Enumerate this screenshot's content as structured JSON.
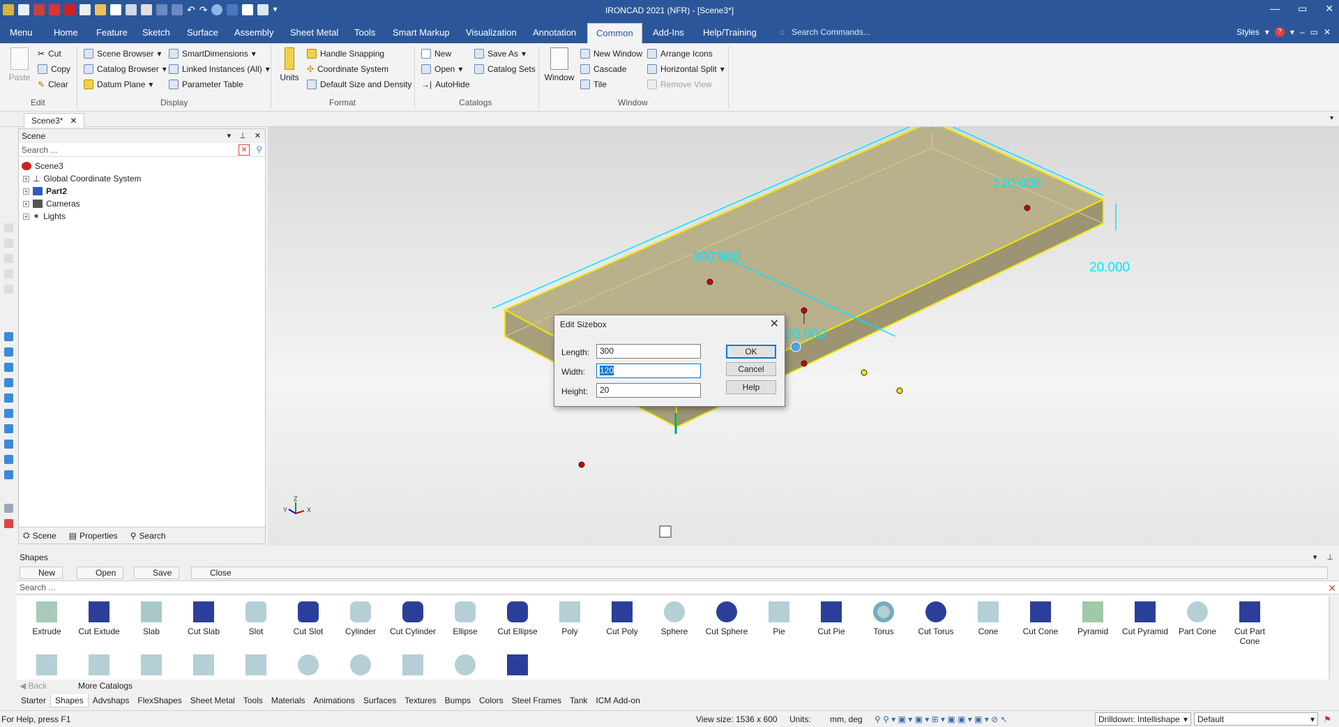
{
  "window": {
    "title": "IRONCAD 2021 (NFR) - [Scene3*]",
    "minimize": "—",
    "maximize": "▭",
    "close": "✕"
  },
  "menu": {
    "tabs": [
      "Menu",
      "Home",
      "Feature",
      "Sketch",
      "Surface",
      "Assembly",
      "Sheet Metal",
      "Tools",
      "Smart Markup",
      "Visualization",
      "Annotation",
      "Common",
      "Add-Ins",
      "Help/Training"
    ],
    "active_tab": "Common",
    "search_placeholder": "Search Commands...",
    "styles": "Styles"
  },
  "ribbon": {
    "edit": {
      "paste": "Paste",
      "cut": "Cut",
      "copy": "Copy",
      "clear": "Clear",
      "label": "Edit"
    },
    "display": {
      "scene_browser": "Scene Browser",
      "catalog_browser": "Catalog Browser",
      "datum_plane": "Datum Plane",
      "smart_dimensions": "SmartDimensions",
      "linked_instances": "Linked Instances (All)",
      "parameter_table": "Parameter Table",
      "label": "Display"
    },
    "format": {
      "units": "Units",
      "handle_snapping": "Handle Snapping",
      "coordinate_system": "Coordinate System",
      "default_size": "Default Size and Density",
      "label": "Format"
    },
    "catalogs": {
      "new": "New",
      "open": "Open",
      "autohide": "AutoHide",
      "save_as": "Save As",
      "catalog_sets": "Catalog Sets",
      "label": "Catalogs"
    },
    "window": {
      "window": "Window",
      "new_window": "New Window",
      "cascade": "Cascade",
      "tile": "Tile",
      "arrange_icons": "Arrange Icons",
      "horizontal_split": "Horizontal Split",
      "remove_view": "Remove View",
      "label": "Window"
    }
  },
  "document_tab": "Scene3*",
  "scene_panel": {
    "title": "Scene",
    "search_placeholder": "Search ...",
    "tree": [
      {
        "label": "Scene3",
        "bold": false
      },
      {
        "label": "Global Coordinate System",
        "bold": false
      },
      {
        "label": "Part2",
        "bold": true
      },
      {
        "label": "Cameras",
        "bold": false
      },
      {
        "label": "Lights",
        "bold": false
      }
    ],
    "tabs": [
      "Scene",
      "Properties",
      "Search"
    ]
  },
  "viewport": {
    "dim_length": "300.000",
    "dim_width": "120.000",
    "dim_height": "20.000",
    "dim_partial": "20.000",
    "triad": {
      "x": "X",
      "y": "Y",
      "z": "Z"
    }
  },
  "dialog": {
    "title": "Edit Sizebox",
    "length_label": "Length:",
    "length_value": "300",
    "width_label": "Width:",
    "width_value": "120",
    "height_label": "Height:",
    "height_value": "20",
    "ok": "OK",
    "cancel": "Cancel",
    "help": "Help"
  },
  "shapes_panel": {
    "title": "Shapes",
    "toolbar": [
      "New",
      "Open",
      "Save",
      "Close"
    ],
    "search_placeholder": "Search ...",
    "items": [
      "Extrude",
      "Cut Extude",
      "Slab",
      "Cut Slab",
      "Slot",
      "Cut Slot",
      "Cylinder",
      "Cut Cylinder",
      "Ellipse",
      "Cut Ellipse",
      "Poly",
      "Cut Poly",
      "Sphere",
      "Cut Sphere",
      "Pie",
      "Cut Pie",
      "Torus",
      "Cut Torus",
      "Cone",
      "Cut Cone",
      "Pyramid",
      "Cut Pyramid",
      "Part Cone",
      "Cut Part Cone"
    ],
    "back": "Back",
    "more_catalogs": "More Catalogs",
    "catalog_tabs": [
      "Starter",
      "Shapes",
      "Advshaps",
      "FlexShapes",
      "Sheet Metal",
      "Tools",
      "Materials",
      "Animations",
      "Surfaces",
      "Textures",
      "Bumps",
      "Colors",
      "Steel Frames",
      "Tank",
      "ICM Add-on"
    ],
    "active_catalog_tab": "Shapes"
  },
  "status_bar": {
    "help": "For Help, press F1",
    "view_size": "View size: 1536 x  600",
    "units_label": "Units:",
    "units_value": "mm, deg",
    "drilldown": "Drilldown: Intellishape",
    "default": "Default"
  },
  "colors": {
    "brand_blue": "#2b579a",
    "dimension_cyan": "#00e5ff",
    "part_fill": "#b5ad87",
    "selection_yellow": "#f2e600"
  }
}
